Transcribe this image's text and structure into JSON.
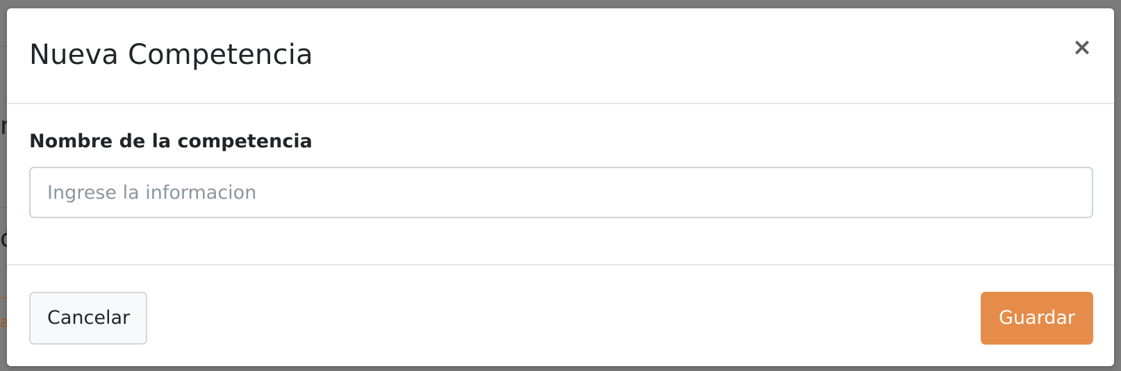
{
  "modal": {
    "title": "Nueva Competencia",
    "close_label": "×"
  },
  "form": {
    "field_label": "Nombre de la competencia",
    "field_value": "",
    "field_placeholder": "Ingrese la informacion"
  },
  "footer": {
    "cancel_label": "Cancelar",
    "save_label": "Guardar"
  },
  "background": {
    "fragments": [
      "r",
      "ó",
      "a"
    ]
  },
  "colors": {
    "accent": "#e58c4a",
    "backdrop": "#7b7b7b",
    "text": "#212529"
  }
}
